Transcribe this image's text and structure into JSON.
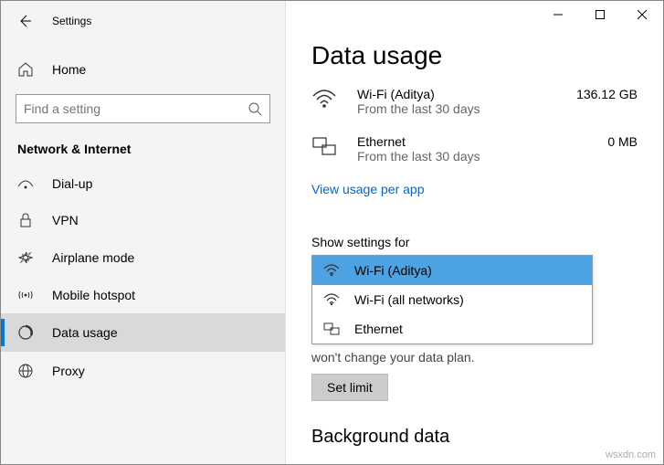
{
  "app": {
    "title": "Settings"
  },
  "home": {
    "label": "Home"
  },
  "search": {
    "placeholder": "Find a setting"
  },
  "category": "Network & Internet",
  "nav": {
    "items": [
      {
        "label": "Dial-up"
      },
      {
        "label": "VPN"
      },
      {
        "label": "Airplane mode"
      },
      {
        "label": "Mobile hotspot"
      },
      {
        "label": "Data usage"
      },
      {
        "label": "Proxy"
      }
    ]
  },
  "main": {
    "title": "Data usage",
    "usage": [
      {
        "name": "Wi-Fi (Aditya)",
        "sub": "From the last 30 days",
        "value": "136.12 GB"
      },
      {
        "name": "Ethernet",
        "sub": "From the last 30 days",
        "value": "0 MB"
      }
    ],
    "link": "View usage per app",
    "show_label": "Show settings for",
    "dropdown": [
      {
        "label": "Wi-Fi (Aditya)"
      },
      {
        "label": "Wi-Fi (all networks)"
      },
      {
        "label": "Ethernet"
      }
    ],
    "truncated": "won't change your data plan.",
    "set_limit": "Set limit",
    "bg_heading": "Background data"
  },
  "watermark": "wsxdn.com"
}
